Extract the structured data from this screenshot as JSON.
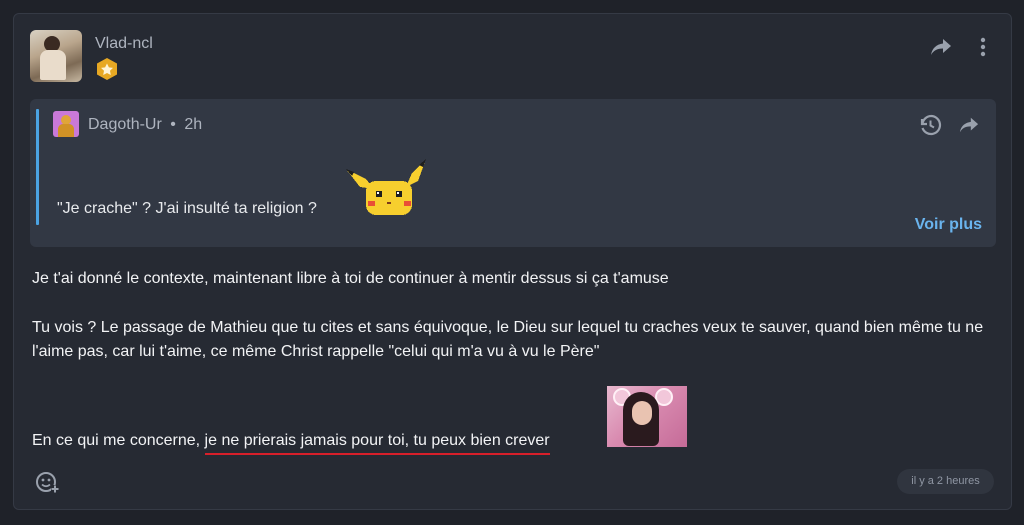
{
  "post": {
    "author": "Vlad-ncl",
    "timestamp": "il y a 2 heures",
    "badge_icon": "star-badge-icon",
    "paragraphs": {
      "p1": "Je t'ai donné le contexte, maintenant libre à toi de continuer à mentir dessus si ça t'amuse",
      "p2": "Tu vois ? Le passage de Mathieu que tu cites et sans équivoque, le Dieu sur lequel tu craches veux te sauver, quand bien même tu ne l'aime pas, car lui t'aime, ce même Christ rappelle \"celui qui m'a vu à vu le Père\"",
      "p3_prefix": "En ce qui me concerne, ",
      "p3_underlined": "je ne prierais jamais pour toi, tu peux bien crever"
    }
  },
  "quote": {
    "author": "Dagoth-Ur",
    "separator": "•",
    "age": "2h",
    "text": "\"Je crache\" ? J'ai insulté ta religion ?",
    "more_label": "Voir plus"
  },
  "colors": {
    "accent": "#4ba3e3",
    "link": "#6ab4ee",
    "underline": "#d81f2a",
    "badge": "#e7a823"
  }
}
